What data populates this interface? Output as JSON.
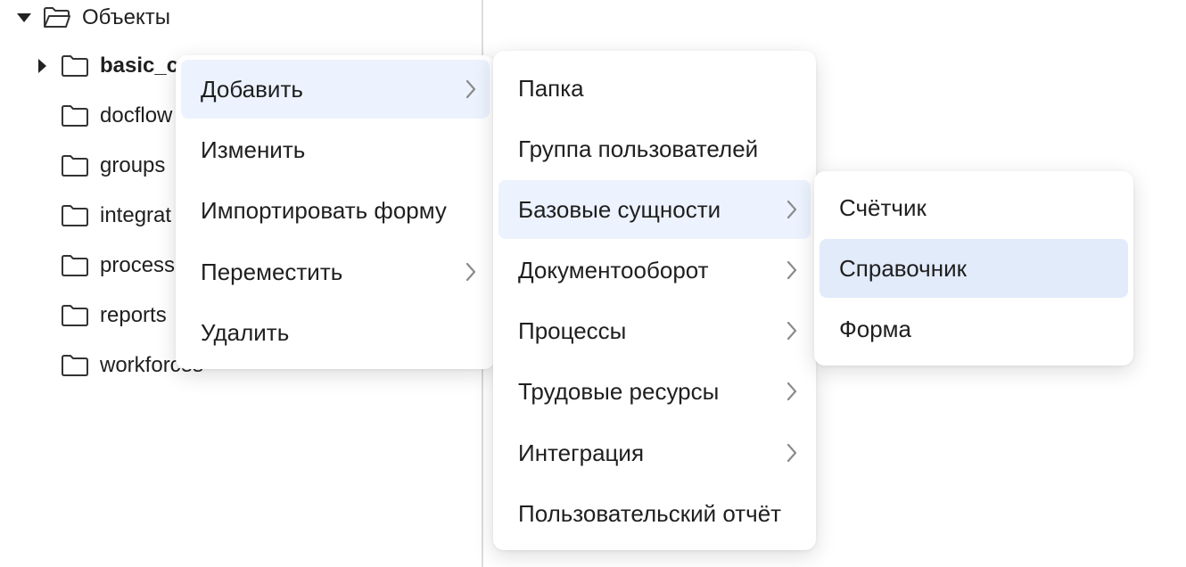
{
  "tree": {
    "root": "Объекты",
    "items": [
      "basic_c",
      "docflow",
      "groups",
      "integrat",
      "process",
      "reports",
      "workforces"
    ]
  },
  "context_menu": {
    "items": [
      {
        "label": "Добавить",
        "submenu": true
      },
      {
        "label": "Изменить",
        "submenu": false
      },
      {
        "label": "Импортировать форму",
        "submenu": false
      },
      {
        "label": "Переместить",
        "submenu": true
      },
      {
        "label": "Удалить",
        "submenu": false
      }
    ]
  },
  "add_submenu": {
    "items": [
      {
        "label": "Папка",
        "submenu": false
      },
      {
        "label": "Группа пользователей",
        "submenu": false
      },
      {
        "label": "Базовые сущности",
        "submenu": true
      },
      {
        "label": "Документооборот",
        "submenu": true
      },
      {
        "label": "Процессы",
        "submenu": true
      },
      {
        "label": "Трудовые ресурсы",
        "submenu": true
      },
      {
        "label": "Интеграция",
        "submenu": true
      },
      {
        "label": "Пользовательский отчёт",
        "submenu": false
      }
    ]
  },
  "base_entities_submenu": {
    "items": [
      {
        "label": "Счётчик"
      },
      {
        "label": "Справочник"
      },
      {
        "label": "Форма"
      }
    ]
  },
  "icons": [
    "caret-down-icon",
    "caret-right-icon",
    "folder-open-icon",
    "folder-icon",
    "chevron-right-icon"
  ],
  "colors": {
    "highlight_light": "#ecf3fe",
    "highlight_strong": "#e2ebfa",
    "text": "#1f1f1f"
  }
}
